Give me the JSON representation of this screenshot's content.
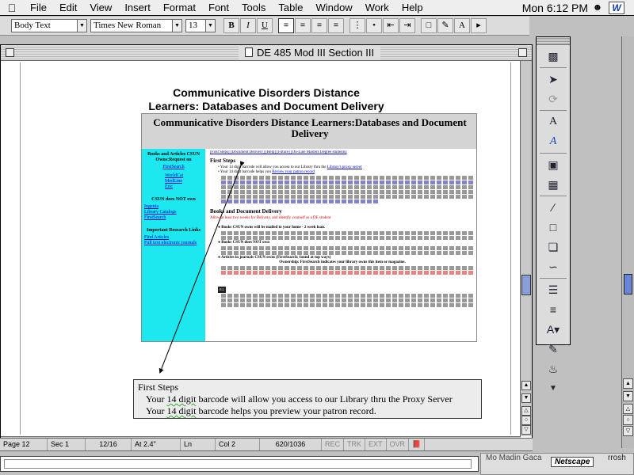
{
  "menubar": {
    "items": [
      "File",
      "Edit",
      "View",
      "Insert",
      "Format",
      "Font",
      "Tools",
      "Table",
      "Window",
      "Work",
      "Help"
    ],
    "clock": "Mon 6:12 PM"
  },
  "format_toolbar": {
    "style": "Body Text",
    "font": "Times New Roman",
    "size": "13"
  },
  "window": {
    "title": "DE 485 Mod III Section III"
  },
  "document": {
    "title": "Communicative Disorders Distance Learners:  Databases and Document Delivery",
    "screenshot": {
      "heading": "Communicative Disorders Distance Learners:Databases and Document Delivery",
      "side_block1_title": "Books and Articles CSUN Owns:Request on",
      "side_block1_link": "FirstSearch",
      "side_block1_items": [
        "WorldCat",
        "MedLine",
        "Eric"
      ],
      "side_block2_title": "CSUN does NOT own",
      "side_block2_links": [
        "Ingenta",
        "Library Catalogs",
        "FirstSearch"
      ],
      "side_block3_title": "Important Research Links",
      "side_block3_links": [
        "Find Articles",
        "Full text electronic journals"
      ],
      "nav": "[First Steps] [Document Delivery] [Help] [Future] [On-Line Masters Degree students]",
      "first_steps_heading": "First Steps",
      "bullet1": "Your 14 digit barcode will allow you access to our Library thru the",
      "bullet1_link": "Library's proxy server",
      "bullet2": "Your 14 digit barcode helps you",
      "bullet2_link": "Review your patron record",
      "books_heading": "Books and Document Delivery",
      "allow_text": "Allow at least two weeks for Delivery, and identify yourself as a DE student",
      "books_line": "Books CSUN owns will be mailed to your home - 2 week loan.",
      "books_not_owned": "Books CSUN does NOT own",
      "articles_owned": "Articles in journals CSUN owns (FirstSearch: found at top ways)",
      "ownership": "Ownership: FirstSearch indicates your library owns this item or magazine.",
      "ill_label": "ILL"
    },
    "callout_title": "First Steps",
    "callout_lines": [
      {
        "pre": "Your ",
        "sq": "14 digit",
        "post": " barcode will allow you access to our Library thru the Proxy Server"
      },
      {
        "pre": "Your ",
        "sq": "14 digit",
        "post": " barcode helps you preview your patron record."
      }
    ]
  },
  "statusbar": {
    "page": "Page 12",
    "section": "Sec 1",
    "pages": "12/16",
    "at": "At 2.4\"",
    "ln": "Ln",
    "col": "Col 2",
    "words": "620/1036",
    "rec": "REC",
    "trk": "TRK",
    "ext": "EXT",
    "ovr": "OVR"
  },
  "netscape": {
    "left": "Mo Madin Gaca",
    "label": "Netscape",
    "right": "rrosh"
  },
  "colors": {
    "sidebar_cyan": "#1de8f0",
    "link_blue": "#0000cc",
    "scroll_thumb": "#8a9fd8",
    "alert_red": "#dd0000"
  }
}
